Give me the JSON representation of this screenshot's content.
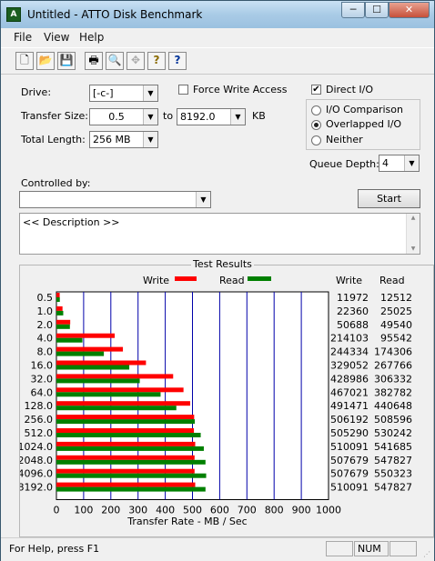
{
  "window": {
    "title": "Untitled - ATTO Disk Benchmark",
    "app_icon": "atto-app-icon",
    "controls": {
      "minimize": "─",
      "maximize": "☐",
      "close": "✕"
    }
  },
  "menu": [
    "File",
    "View",
    "Help"
  ],
  "toolbar": {
    "icons": [
      "new-file-icon",
      "open-folder-icon",
      "save-icon",
      "print-icon",
      "print-preview-icon",
      "move-icon",
      "help-icon",
      "context-help-icon"
    ],
    "glyphs": [
      "🗋",
      "📂",
      "💾",
      "🖶",
      "🔍",
      "✥",
      "?",
      "?"
    ]
  },
  "form": {
    "drive_label": "Drive:",
    "drive_value": "[-c-]",
    "force_write_label": "Force Write Access",
    "force_write_checked": false,
    "direct_io_label": "Direct I/O",
    "direct_io_checked": true,
    "transfer_size_label": "Transfer Size:",
    "transfer_from": "0.5",
    "to_label": "to",
    "transfer_to": "8192.0",
    "kb_label": "KB",
    "total_length_label": "Total Length:",
    "total_length_value": "256 MB",
    "radio_options": [
      {
        "label": "I/O Comparison",
        "checked": false
      },
      {
        "label": "Overlapped I/O",
        "checked": true
      },
      {
        "label": "Neither",
        "checked": false
      }
    ],
    "queue_depth_label": "Queue Depth:",
    "queue_depth_value": "4",
    "controlled_by_label": "Controlled by:",
    "controlled_by_value": "",
    "start_label": "Start",
    "description_text": "<< Description >>",
    "check_mark": "✔",
    "dropdown_glyph": "▼"
  },
  "results": {
    "title": "Test Results",
    "write_legend": "Write",
    "read_legend": "Read",
    "write_col": "Write",
    "read_col": "Read",
    "write_color": "#ff0000",
    "read_color": "#008000"
  },
  "chart_data": {
    "type": "bar",
    "orientation": "horizontal",
    "title": "Test Results",
    "xlabel": "Transfer Rate - MB / Sec",
    "ylabel": "",
    "xlim": [
      0,
      1000
    ],
    "xticks": [
      0,
      100,
      200,
      300,
      400,
      500,
      600,
      700,
      800,
      900,
      1000
    ],
    "categories": [
      "0.5",
      "1.0",
      "2.0",
      "4.0",
      "8.0",
      "16.0",
      "32.0",
      "64.0",
      "128.0",
      "256.0",
      "512.0",
      "1024.0",
      "2048.0",
      "4096.0",
      "8192.0"
    ],
    "series": [
      {
        "name": "Write",
        "color": "#ff0000",
        "values": [
          11.972,
          22.36,
          50.688,
          214.103,
          244.334,
          329.052,
          428.986,
          467.021,
          491.471,
          506.192,
          505.29,
          510.091,
          507.679,
          507.679,
          510.091
        ]
      },
      {
        "name": "Read",
        "color": "#008000",
        "values": [
          12.512,
          25.025,
          49.54,
          95.542,
          174.306,
          267.766,
          306.332,
          382.782,
          440.648,
          508.596,
          530.242,
          541.685,
          547.827,
          550.323,
          547.827
        ]
      }
    ],
    "write_table": [
      "11972",
      "22360",
      "50688",
      "214103",
      "244334",
      "329052",
      "428986",
      "467021",
      "491471",
      "506192",
      "505290",
      "510091",
      "507679",
      "507679",
      "510091"
    ],
    "read_table": [
      "12512",
      "25025",
      "49540",
      "95542",
      "174306",
      "267766",
      "306332",
      "382782",
      "440648",
      "508596",
      "530242",
      "541685",
      "547827",
      "550323",
      "547827"
    ],
    "grid": true,
    "gridline_color": "#0000aa",
    "legend_position": "top"
  },
  "status": {
    "help_text": "For Help, press F1",
    "num": "NUM",
    "grip": "⋰"
  }
}
